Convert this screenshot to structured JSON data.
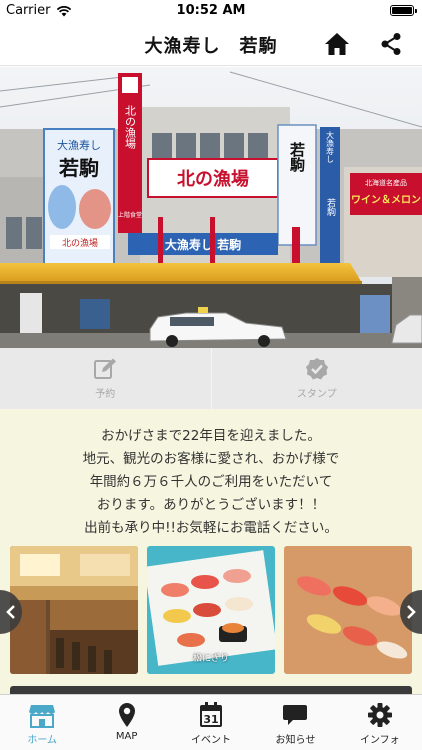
{
  "status": {
    "carrier": "Carrier",
    "time": "10:52 AM"
  },
  "nav": {
    "title": "大漁寿し　若駒",
    "home_icon": "home-icon",
    "share_icon": "share-icon"
  },
  "hero": {
    "signs": {
      "left_brand": "大漁寿し",
      "left_name": "若駒",
      "left_banner": "北の漁場",
      "red_vertical": "北の漁場",
      "red_tag": "上階食堂",
      "center_big": "北の漁場",
      "bottom_band": "大漁寿し 若駒",
      "right_panel": "若駒",
      "right_blue": "大漁寿し",
      "right_blue_2": "若駒",
      "far_right_top": "北海道名産品",
      "far_right_main": "ワイン＆メロン"
    }
  },
  "actions": [
    {
      "label": "予約",
      "icon": "edit-icon"
    },
    {
      "label": "スタンプ",
      "icon": "check-badge-icon"
    }
  ],
  "info": {
    "lines": [
      "おかげさまで22年目を迎えました。",
      "地元、観光のお客様に愛され、おかげ様で",
      "年間約６万６千人のご利用をいただいて",
      "おります。ありがとうございます！！",
      "出前も承り中!!お気軽にお電話ください。"
    ]
  },
  "gallery": {
    "photos": [
      {
        "alt": "店内カウンター"
      },
      {
        "alt": "寿司盛り合わせ",
        "caption": "松にぎり"
      },
      {
        "alt": "寿司盛り合わせ"
      }
    ],
    "prev_icon": "chevron-left-icon",
    "next_icon": "chevron-right-icon"
  },
  "tabs": [
    {
      "label": "ホーム",
      "icon": "shop-icon",
      "active": true
    },
    {
      "label": "MAP",
      "icon": "map-pin-icon"
    },
    {
      "label": "イベント",
      "icon": "calendar-icon",
      "day": "31"
    },
    {
      "label": "お知らせ",
      "icon": "chat-bubble-icon"
    },
    {
      "label": "インフォ",
      "icon": "gear-icon"
    }
  ],
  "colors": {
    "accent": "#4aa8c8",
    "info_bg": "#f6f6e0",
    "action_bg": "#e9e9e9"
  }
}
